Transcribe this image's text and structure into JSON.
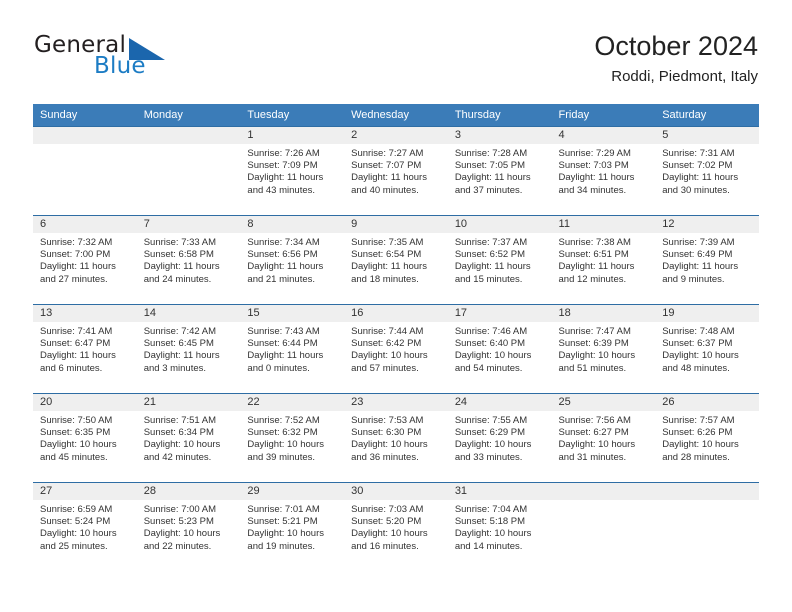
{
  "logo": {
    "part1": "General",
    "part2": "Blue",
    "triangle_color": "#1b66ad"
  },
  "header": {
    "title": "October 2024",
    "subtitle": "Roddi, Piedmont, Italy"
  },
  "colors": {
    "header_row_bg": "#3b7cb8",
    "daynum_strip_bg": "#efefef",
    "cell_border": "#2e6da4",
    "text": "#333333"
  },
  "calendar": {
    "weekday_headers": [
      "Sunday",
      "Monday",
      "Tuesday",
      "Wednesday",
      "Thursday",
      "Friday",
      "Saturday"
    ],
    "weeks": [
      [
        {
          "day": "",
          "empty": true
        },
        {
          "day": "",
          "empty": true
        },
        {
          "day": "1",
          "sunrise": "Sunrise: 7:26 AM",
          "sunset": "Sunset: 7:09 PM",
          "daylight1": "Daylight: 11 hours",
          "daylight2": "and 43 minutes."
        },
        {
          "day": "2",
          "sunrise": "Sunrise: 7:27 AM",
          "sunset": "Sunset: 7:07 PM",
          "daylight1": "Daylight: 11 hours",
          "daylight2": "and 40 minutes."
        },
        {
          "day": "3",
          "sunrise": "Sunrise: 7:28 AM",
          "sunset": "Sunset: 7:05 PM",
          "daylight1": "Daylight: 11 hours",
          "daylight2": "and 37 minutes."
        },
        {
          "day": "4",
          "sunrise": "Sunrise: 7:29 AM",
          "sunset": "Sunset: 7:03 PM",
          "daylight1": "Daylight: 11 hours",
          "daylight2": "and 34 minutes."
        },
        {
          "day": "5",
          "sunrise": "Sunrise: 7:31 AM",
          "sunset": "Sunset: 7:02 PM",
          "daylight1": "Daylight: 11 hours",
          "daylight2": "and 30 minutes."
        }
      ],
      [
        {
          "day": "6",
          "sunrise": "Sunrise: 7:32 AM",
          "sunset": "Sunset: 7:00 PM",
          "daylight1": "Daylight: 11 hours",
          "daylight2": "and 27 minutes."
        },
        {
          "day": "7",
          "sunrise": "Sunrise: 7:33 AM",
          "sunset": "Sunset: 6:58 PM",
          "daylight1": "Daylight: 11 hours",
          "daylight2": "and 24 minutes."
        },
        {
          "day": "8",
          "sunrise": "Sunrise: 7:34 AM",
          "sunset": "Sunset: 6:56 PM",
          "daylight1": "Daylight: 11 hours",
          "daylight2": "and 21 minutes."
        },
        {
          "day": "9",
          "sunrise": "Sunrise: 7:35 AM",
          "sunset": "Sunset: 6:54 PM",
          "daylight1": "Daylight: 11 hours",
          "daylight2": "and 18 minutes."
        },
        {
          "day": "10",
          "sunrise": "Sunrise: 7:37 AM",
          "sunset": "Sunset: 6:52 PM",
          "daylight1": "Daylight: 11 hours",
          "daylight2": "and 15 minutes."
        },
        {
          "day": "11",
          "sunrise": "Sunrise: 7:38 AM",
          "sunset": "Sunset: 6:51 PM",
          "daylight1": "Daylight: 11 hours",
          "daylight2": "and 12 minutes."
        },
        {
          "day": "12",
          "sunrise": "Sunrise: 7:39 AM",
          "sunset": "Sunset: 6:49 PM",
          "daylight1": "Daylight: 11 hours",
          "daylight2": "and 9 minutes."
        }
      ],
      [
        {
          "day": "13",
          "sunrise": "Sunrise: 7:41 AM",
          "sunset": "Sunset: 6:47 PM",
          "daylight1": "Daylight: 11 hours",
          "daylight2": "and 6 minutes."
        },
        {
          "day": "14",
          "sunrise": "Sunrise: 7:42 AM",
          "sunset": "Sunset: 6:45 PM",
          "daylight1": "Daylight: 11 hours",
          "daylight2": "and 3 minutes."
        },
        {
          "day": "15",
          "sunrise": "Sunrise: 7:43 AM",
          "sunset": "Sunset: 6:44 PM",
          "daylight1": "Daylight: 11 hours",
          "daylight2": "and 0 minutes."
        },
        {
          "day": "16",
          "sunrise": "Sunrise: 7:44 AM",
          "sunset": "Sunset: 6:42 PM",
          "daylight1": "Daylight: 10 hours",
          "daylight2": "and 57 minutes."
        },
        {
          "day": "17",
          "sunrise": "Sunrise: 7:46 AM",
          "sunset": "Sunset: 6:40 PM",
          "daylight1": "Daylight: 10 hours",
          "daylight2": "and 54 minutes."
        },
        {
          "day": "18",
          "sunrise": "Sunrise: 7:47 AM",
          "sunset": "Sunset: 6:39 PM",
          "daylight1": "Daylight: 10 hours",
          "daylight2": "and 51 minutes."
        },
        {
          "day": "19",
          "sunrise": "Sunrise: 7:48 AM",
          "sunset": "Sunset: 6:37 PM",
          "daylight1": "Daylight: 10 hours",
          "daylight2": "and 48 minutes."
        }
      ],
      [
        {
          "day": "20",
          "sunrise": "Sunrise: 7:50 AM",
          "sunset": "Sunset: 6:35 PM",
          "daylight1": "Daylight: 10 hours",
          "daylight2": "and 45 minutes."
        },
        {
          "day": "21",
          "sunrise": "Sunrise: 7:51 AM",
          "sunset": "Sunset: 6:34 PM",
          "daylight1": "Daylight: 10 hours",
          "daylight2": "and 42 minutes."
        },
        {
          "day": "22",
          "sunrise": "Sunrise: 7:52 AM",
          "sunset": "Sunset: 6:32 PM",
          "daylight1": "Daylight: 10 hours",
          "daylight2": "and 39 minutes."
        },
        {
          "day": "23",
          "sunrise": "Sunrise: 7:53 AM",
          "sunset": "Sunset: 6:30 PM",
          "daylight1": "Daylight: 10 hours",
          "daylight2": "and 36 minutes."
        },
        {
          "day": "24",
          "sunrise": "Sunrise: 7:55 AM",
          "sunset": "Sunset: 6:29 PM",
          "daylight1": "Daylight: 10 hours",
          "daylight2": "and 33 minutes."
        },
        {
          "day": "25",
          "sunrise": "Sunrise: 7:56 AM",
          "sunset": "Sunset: 6:27 PM",
          "daylight1": "Daylight: 10 hours",
          "daylight2": "and 31 minutes."
        },
        {
          "day": "26",
          "sunrise": "Sunrise: 7:57 AM",
          "sunset": "Sunset: 6:26 PM",
          "daylight1": "Daylight: 10 hours",
          "daylight2": "and 28 minutes."
        }
      ],
      [
        {
          "day": "27",
          "sunrise": "Sunrise: 6:59 AM",
          "sunset": "Sunset: 5:24 PM",
          "daylight1": "Daylight: 10 hours",
          "daylight2": "and 25 minutes."
        },
        {
          "day": "28",
          "sunrise": "Sunrise: 7:00 AM",
          "sunset": "Sunset: 5:23 PM",
          "daylight1": "Daylight: 10 hours",
          "daylight2": "and 22 minutes."
        },
        {
          "day": "29",
          "sunrise": "Sunrise: 7:01 AM",
          "sunset": "Sunset: 5:21 PM",
          "daylight1": "Daylight: 10 hours",
          "daylight2": "and 19 minutes."
        },
        {
          "day": "30",
          "sunrise": "Sunrise: 7:03 AM",
          "sunset": "Sunset: 5:20 PM",
          "daylight1": "Daylight: 10 hours",
          "daylight2": "and 16 minutes."
        },
        {
          "day": "31",
          "sunrise": "Sunrise: 7:04 AM",
          "sunset": "Sunset: 5:18 PM",
          "daylight1": "Daylight: 10 hours",
          "daylight2": "and 14 minutes."
        },
        {
          "day": "",
          "empty": true
        },
        {
          "day": "",
          "empty": true
        }
      ]
    ]
  }
}
